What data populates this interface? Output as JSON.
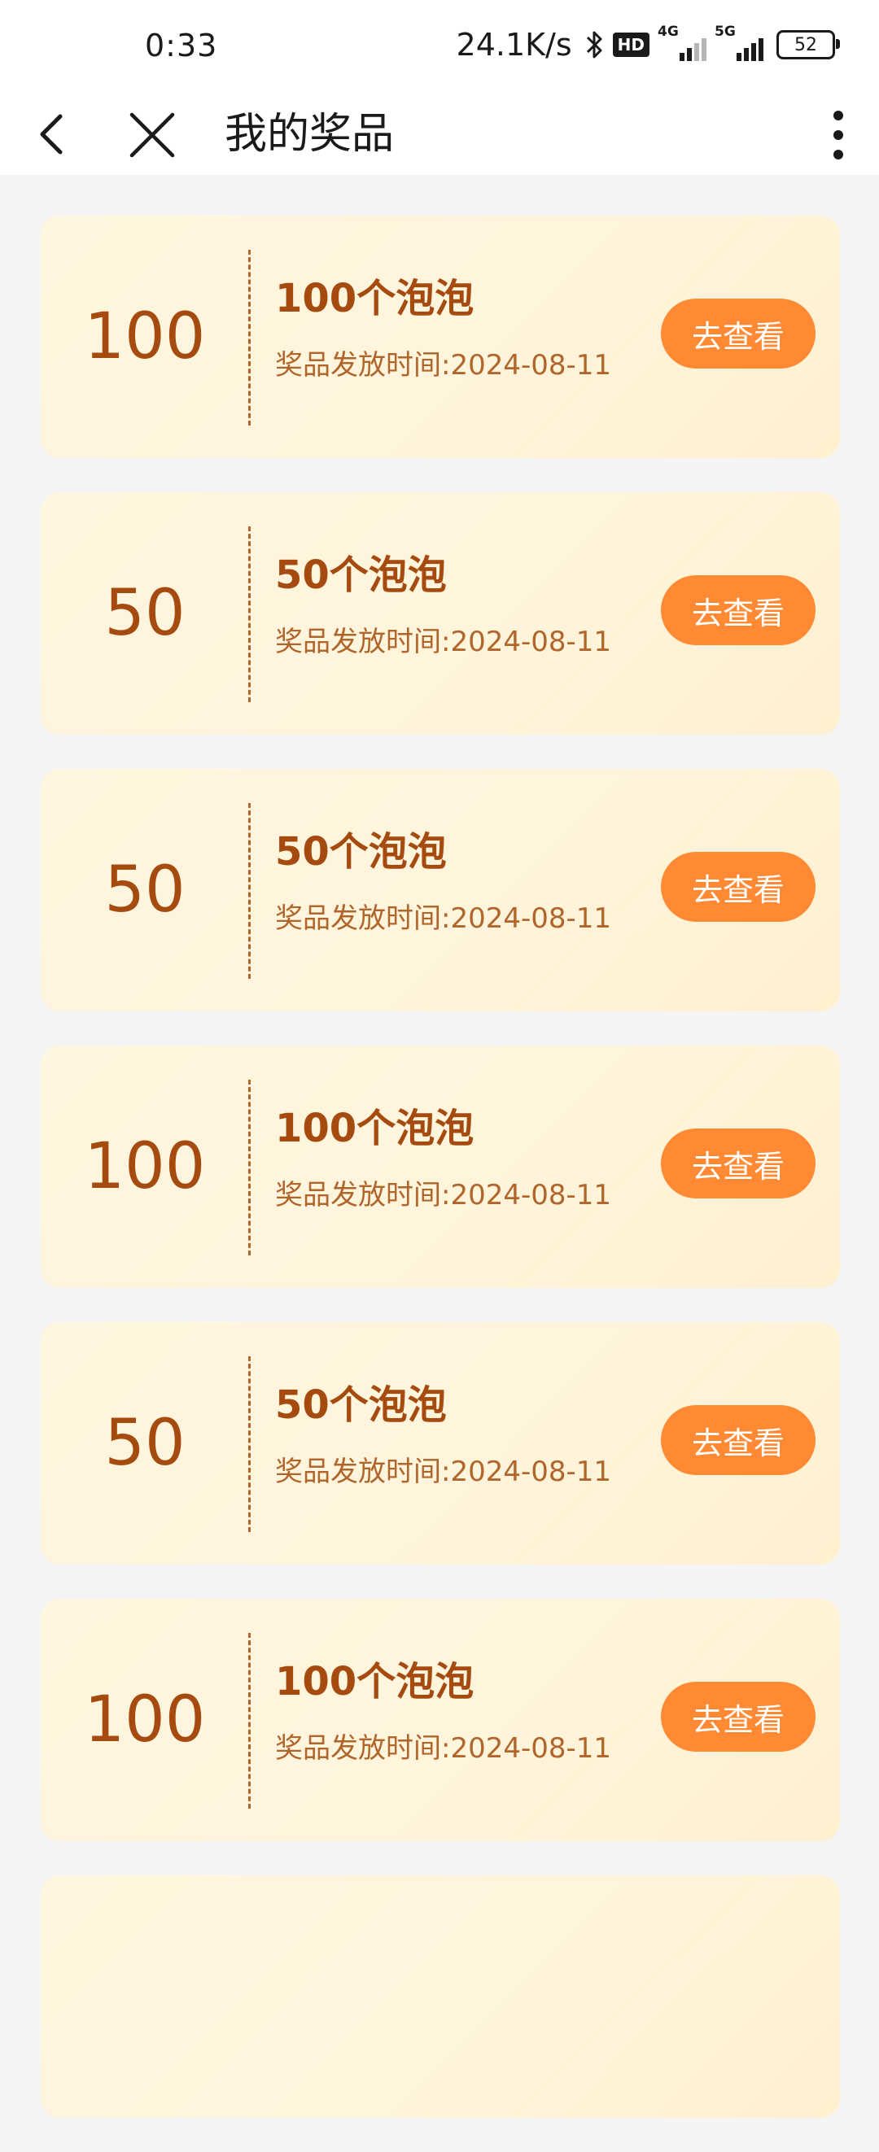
{
  "status_bar": {
    "time": "0:33",
    "net_speed": "24.1K/s",
    "hd_label": "HD",
    "sig1_label": "4G",
    "sig2_label": "5G",
    "battery": "52"
  },
  "nav": {
    "title": "我的奖品"
  },
  "colors": {
    "accent": "#ff8a33",
    "text_brown": "#a64b10",
    "card_bg": "#fff4dc"
  },
  "prizes": [
    {
      "amount": "100",
      "name": "100个泡泡",
      "time": "奖品发放时间:2024-08-11",
      "button": "去查看"
    },
    {
      "amount": "50",
      "name": "50个泡泡",
      "time": "奖品发放时间:2024-08-11",
      "button": "去查看"
    },
    {
      "amount": "50",
      "name": "50个泡泡",
      "time": "奖品发放时间:2024-08-11",
      "button": "去查看"
    },
    {
      "amount": "100",
      "name": "100个泡泡",
      "time": "奖品发放时间:2024-08-11",
      "button": "去查看"
    },
    {
      "amount": "50",
      "name": "50个泡泡",
      "time": "奖品发放时间:2024-08-11",
      "button": "去查看"
    },
    {
      "amount": "100",
      "name": "100个泡泡",
      "time": "奖品发放时间:2024-08-11",
      "button": "去查看"
    },
    {
      "amount": "",
      "name": "",
      "time": "",
      "button": ""
    }
  ]
}
